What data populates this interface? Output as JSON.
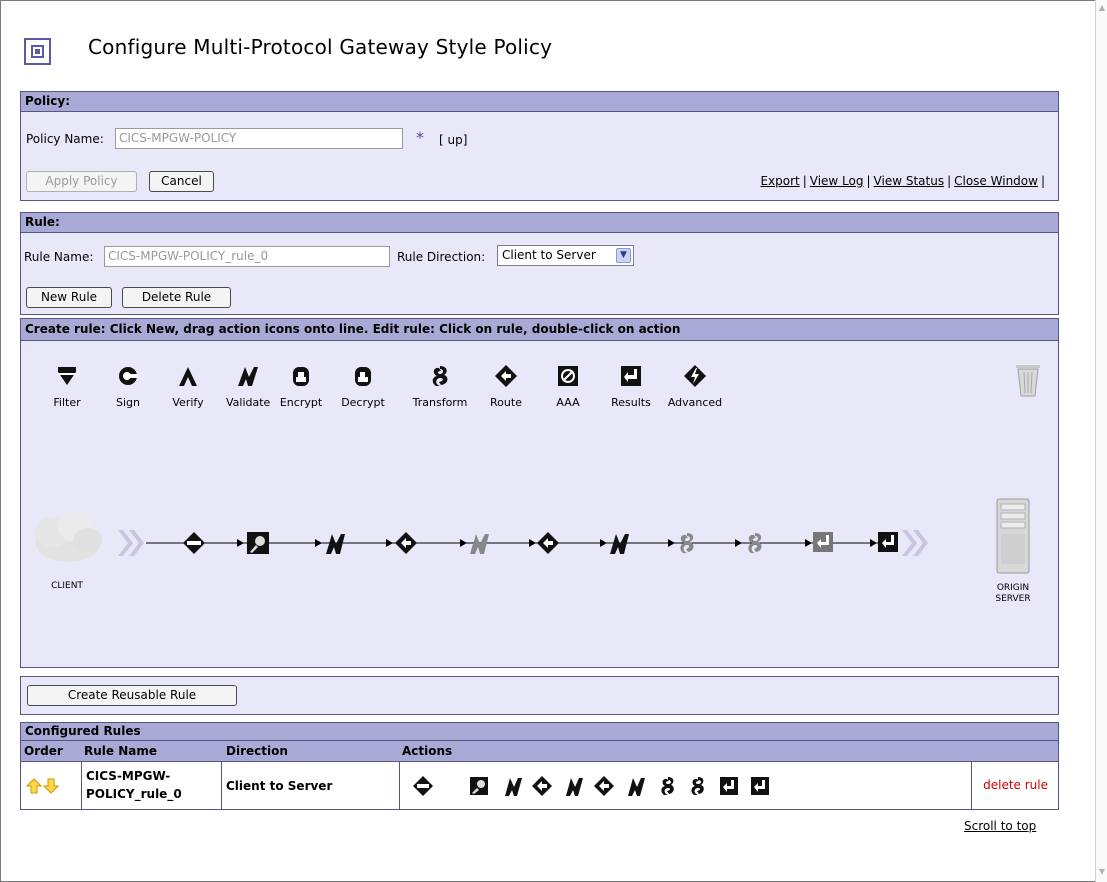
{
  "window": {
    "title": "Configure Multi-Protocol Gateway Style Policy",
    "accent_color": "#a9a9d5",
    "panel_color": "#e8e8f8"
  },
  "policy": {
    "section_label": "Policy:",
    "name_label": "Policy Name:",
    "name_value": "CICS-MPGW-POLICY",
    "required_marker": "*",
    "up_text": "[ up]",
    "apply_button": "Apply Policy",
    "cancel_button": "Cancel",
    "links": [
      "Export",
      "View Log",
      "View Status",
      "Close Window"
    ]
  },
  "rule": {
    "section_label": "Rule:",
    "name_label": "Rule Name:",
    "name_value": "CICS-MPGW-POLICY_rule_0",
    "direction_label": "Rule Direction:",
    "direction_value": "Client to Server",
    "new_button": "New Rule",
    "delete_button": "Delete Rule"
  },
  "editor": {
    "instructions": "Create rule: Click New, drag action icons onto line.     Edit rule: Click on rule, double-click on action",
    "palette": [
      {
        "label": "Filter",
        "icon": "filter-icon"
      },
      {
        "label": "Sign",
        "icon": "sign-icon"
      },
      {
        "label": "Verify",
        "icon": "verify-icon"
      },
      {
        "label": "Validate",
        "icon": "validate-icon"
      },
      {
        "label": "Encrypt",
        "icon": "encrypt-icon"
      },
      {
        "label": "Decrypt",
        "icon": "decrypt-icon"
      },
      {
        "label": "Transform",
        "icon": "transform-icon"
      },
      {
        "label": "Route",
        "icon": "route-icon"
      },
      {
        "label": "AAA",
        "icon": "aaa-icon"
      },
      {
        "label": "Results",
        "icon": "results-icon"
      },
      {
        "label": "Advanced",
        "icon": "advanced-icon"
      }
    ],
    "client_label": "CLIENT",
    "server_label_1": "ORIGIN",
    "server_label_2": "SERVER",
    "pipeline_actions": [
      "match-icon",
      "fetch-icon",
      "validate-icon",
      "route-icon",
      "validate-icon",
      "route-icon",
      "validate-icon",
      "transform-icon",
      "transform-icon",
      "results-icon",
      "results-icon"
    ],
    "reusable_button": "Create Reusable Rule"
  },
  "configured": {
    "title": "Configured Rules",
    "columns": [
      "Order",
      "Rule Name",
      "Direction",
      "Actions"
    ],
    "row": {
      "rule_name_1": "CICS-MPGW-",
      "rule_name_2": "POLICY_rule_0",
      "direction": "Client to Server",
      "delete": "delete rule"
    },
    "scroll_top": "Scroll to top"
  }
}
